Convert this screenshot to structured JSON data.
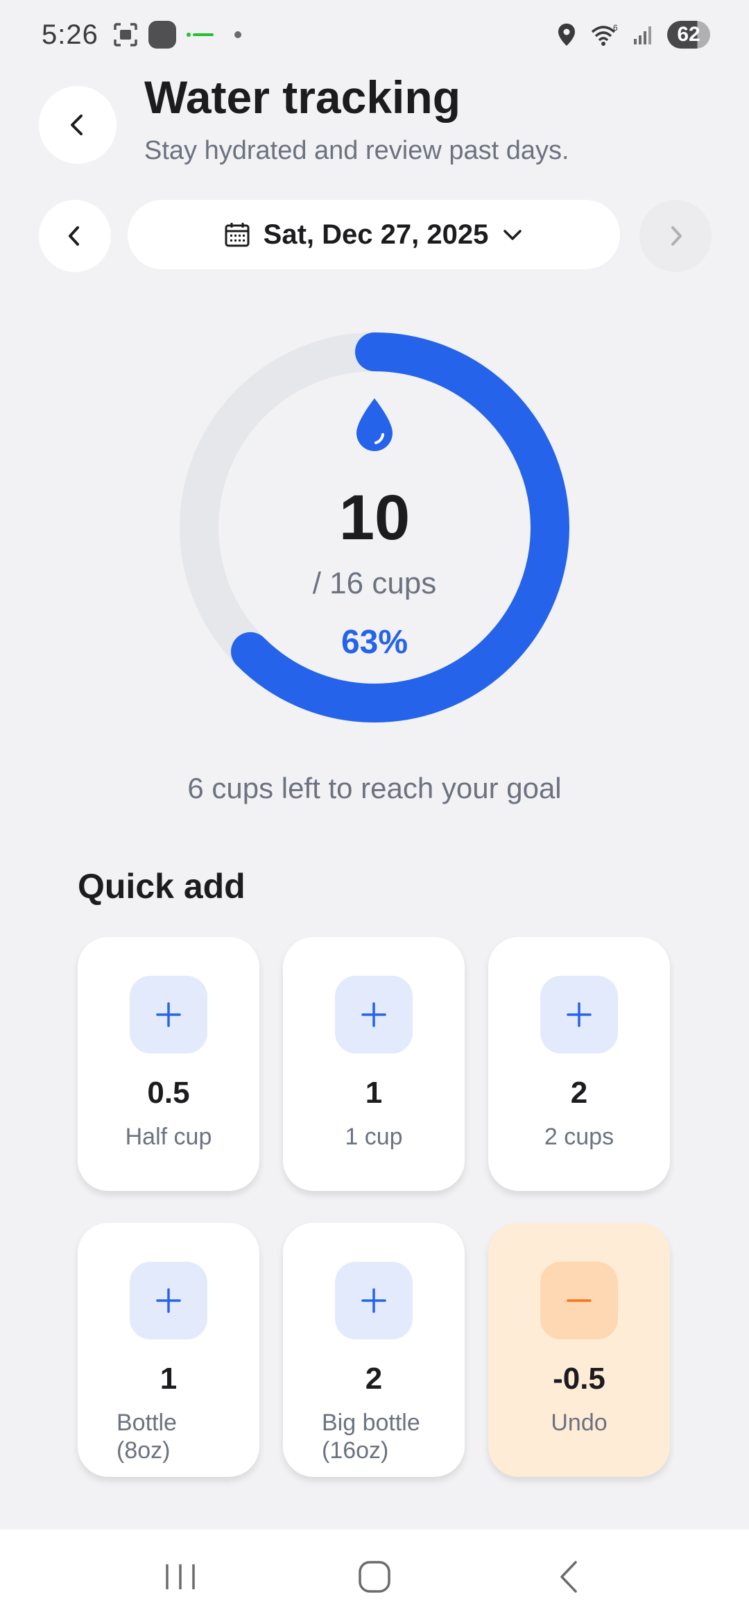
{
  "status_bar": {
    "time": "5:26",
    "battery": "62"
  },
  "header": {
    "title": "Water tracking",
    "subtitle": "Stay hydrated and review past days."
  },
  "date_nav": {
    "date": "Sat, Dec 27, 2025"
  },
  "progress": {
    "value": "10",
    "goal_text": "/ 16 cups",
    "percent_text": "63%",
    "fraction": 0.625,
    "accent_color": "#2563eb",
    "track_color": "#e5e7eb",
    "remaining_text": "6 cups left to reach your goal"
  },
  "quick_add": {
    "title": "Quick add",
    "items": [
      {
        "amount": "0.5",
        "label": "Half cup",
        "icon": "plus-icon"
      },
      {
        "amount": "1",
        "label": "1 cup",
        "icon": "plus-icon"
      },
      {
        "amount": "2",
        "label": "2 cups",
        "icon": "plus-icon"
      },
      {
        "amount": "1",
        "label_line1": "Bottle",
        "label_line2": "(8oz)",
        "icon": "plus-icon"
      },
      {
        "amount": "2",
        "label_line1": "Big bottle",
        "label_line2": "(16oz)",
        "icon": "plus-icon"
      },
      {
        "amount": "-0.5",
        "label": "Undo",
        "icon": "minus-icon"
      }
    ]
  },
  "colors": {
    "background": "#f2f2f4",
    "undo_background": "#feecd6",
    "undo_accent": "#f97316"
  }
}
